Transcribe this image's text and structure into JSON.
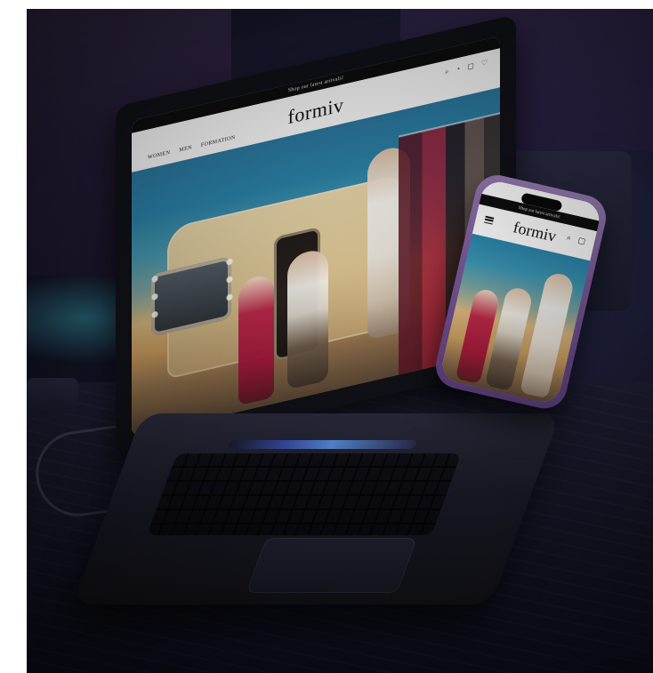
{
  "laptop_site": {
    "promo_text": "Shop our latest arrivals!",
    "logo": "formiv",
    "nav": [
      "WOMEN",
      "MEN",
      "FORMATION"
    ],
    "icons": [
      "search-icon",
      "account-icon",
      "bag-icon",
      "heart-icon"
    ]
  },
  "phone_site": {
    "promo_text": "Shop our latest arrivals!",
    "logo": "formiv",
    "icons": [
      "menu-icon",
      "search-icon",
      "bag-icon"
    ]
  },
  "colors": {
    "background_dark": "#0f1020",
    "accent_purple": "#7b5a9c",
    "screen_white": "#ffffff",
    "promo_black": "#0e0e0e"
  }
}
